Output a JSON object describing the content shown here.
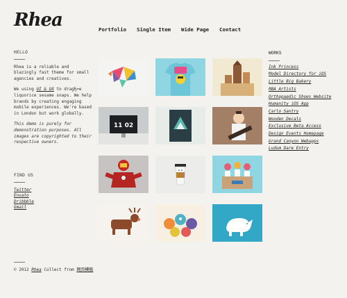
{
  "brand": {
    "logo": "Rhea"
  },
  "nav": [
    "Portfolio",
    "Single Item",
    "Wide Page",
    "Contact"
  ],
  "hello": {
    "heading": "HELLO",
    "p1": "Rhea is a reliable and blazingly fast theme for small agencies and creatives.",
    "p2_prefix": "We using ",
    "p2_link": "UI & UX",
    "p2_suffix": " to dragЂ¤e liquorice sesame snaps. We help brands by creating engaging mobile experiences. We're based in London but work globally.",
    "p3": "This demo is purely for demonstration purposes. All images are copyrighted to their respective owners."
  },
  "find_us": {
    "heading": "FIND US",
    "links": [
      "Twitter",
      "Envato",
      "Dribbble",
      "Gmail"
    ]
  },
  "footer": {
    "prefix": "© 2012 ",
    "link": "Rhea",
    "middle": " Collect from ",
    "link2": "网页模板"
  },
  "works": {
    "heading": "WORKS",
    "links": [
      "Ink Princess",
      "Model Directory for iOS",
      "Little Big Bakery",
      "RBA Artists",
      "Orthopaedic Shoes Website",
      "Humanity iOS App",
      "Carlo Santry",
      "Wooden Decals",
      "Exclusive Beta Access",
      "Design Events Homepage",
      "Grand Canyon Webapps",
      "Ludum Dare Entry"
    ]
  },
  "tiles": [
    {
      "icon": "colorful-bird-icon"
    },
    {
      "icon": "tshirt-icon"
    },
    {
      "icon": "city-castle-icon"
    },
    {
      "icon": "monitor-icon",
      "text": "11 02"
    },
    {
      "icon": "poster-icon"
    },
    {
      "icon": "guitarist-icon"
    },
    {
      "icon": "ironman-icon"
    },
    {
      "icon": "coffee-cup-icon"
    },
    {
      "icon": "flower-pots-icon"
    },
    {
      "icon": "moose-icon"
    },
    {
      "icon": "monsters-icon"
    },
    {
      "icon": "rhino-icon"
    }
  ],
  "colors": {
    "bg": "#f4f2ee",
    "tile_teal": "#32a7c6",
    "tile_sky": "#8fd6e2"
  }
}
